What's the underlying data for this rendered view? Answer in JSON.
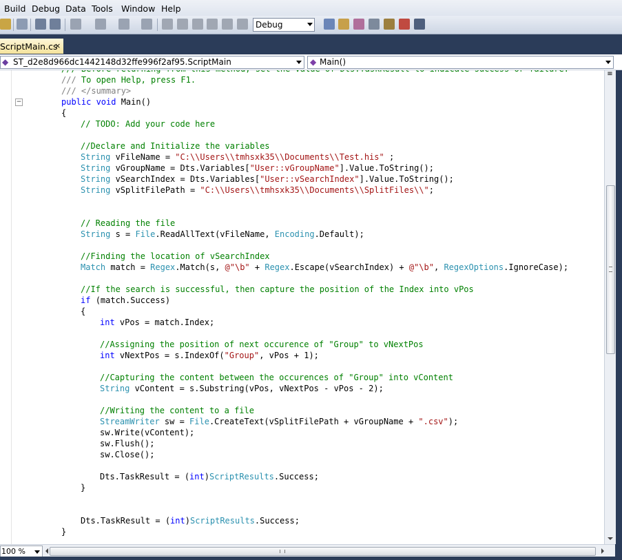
{
  "menu": [
    "Build",
    "Debug",
    "Data",
    "Tools",
    "Window",
    "Help"
  ],
  "toolbar": {
    "configuration": "Debug"
  },
  "tab": {
    "title": "ScriptMain.cs",
    "close": "×"
  },
  "nav": {
    "class_dropdown": "ST_d2e8d966dc1442148d32ffe996f2af95.ScriptMain",
    "member_dropdown": "Main()"
  },
  "code_lines": [
    [
      [
        "c",
        "/// Before returning from this method, set the value of Dts.TaskResult to indicate success or failure."
      ]
    ],
    [
      [
        "d",
        "/// "
      ],
      [
        "c",
        "To open Help, press F1."
      ]
    ],
    [
      [
        "d",
        "/// </summary>"
      ]
    ],
    [
      [
        "k",
        "public void "
      ],
      [
        "txt",
        "Main()"
      ]
    ],
    [
      [
        "txt",
        "{"
      ]
    ],
    [
      [
        "c",
        "// TODO: Add your code here"
      ]
    ],
    [],
    [
      [
        "c",
        "//Declare and Initialize the variables"
      ]
    ],
    [
      [
        "t",
        "String "
      ],
      [
        "txt",
        "vFileName = "
      ],
      [
        "s",
        "\"C:\\\\Users\\\\tmhsxk35\\\\Documents\\\\Test.his\""
      ],
      [
        "txt",
        " ;"
      ]
    ],
    [
      [
        "t",
        "String "
      ],
      [
        "txt",
        "vGroupName = Dts.Variables["
      ],
      [
        "s",
        "\"User::vGroupName\""
      ],
      [
        "txt",
        "].Value.ToString();"
      ]
    ],
    [
      [
        "t",
        "String "
      ],
      [
        "txt",
        "vSearchIndex = Dts.Variables["
      ],
      [
        "s",
        "\"User::vSearchIndex\""
      ],
      [
        "txt",
        "].Value.ToString();"
      ]
    ],
    [
      [
        "t",
        "String "
      ],
      [
        "txt",
        "vSplitFilePath = "
      ],
      [
        "s",
        "\"C:\\\\Users\\\\tmhsxk35\\\\Documents\\\\SplitFiles\\\\\""
      ],
      [
        "txt",
        ";"
      ]
    ],
    [],
    [],
    [
      [
        "c",
        "// Reading the file"
      ]
    ],
    [
      [
        "t",
        "String "
      ],
      [
        "txt",
        "s = "
      ],
      [
        "t",
        "File"
      ],
      [
        "txt",
        ".ReadAllText(vFileName, "
      ],
      [
        "t",
        "Encoding"
      ],
      [
        "txt",
        ".Default);"
      ]
    ],
    [],
    [
      [
        "c",
        "//Finding the location of vSearchIndex"
      ]
    ],
    [
      [
        "t",
        "Match "
      ],
      [
        "txt",
        "match = "
      ],
      [
        "t",
        "Regex"
      ],
      [
        "txt",
        ".Match(s, "
      ],
      [
        "s",
        "@\"\\b\""
      ],
      [
        "txt",
        " + "
      ],
      [
        "t",
        "Regex"
      ],
      [
        "txt",
        ".Escape(vSearchIndex) + "
      ],
      [
        "s",
        "@\"\\b\""
      ],
      [
        "txt",
        ", "
      ],
      [
        "t",
        "RegexOptions"
      ],
      [
        "txt",
        ".IgnoreCase);"
      ]
    ],
    [],
    [
      [
        "c",
        "//If the search is successful, then capture the position of the Index into vPos"
      ]
    ],
    [
      [
        "k",
        "if "
      ],
      [
        "txt",
        "(match.Success)"
      ]
    ],
    [
      [
        "txt",
        "{"
      ]
    ],
    [
      [
        "k",
        "int "
      ],
      [
        "txt",
        "vPos = match.Index;"
      ]
    ],
    [],
    [
      [
        "c",
        "//Assigning the position of next occurence of \"Group\" to vNextPos"
      ]
    ],
    [
      [
        "k",
        "int "
      ],
      [
        "txt",
        "vNextPos = s.IndexOf("
      ],
      [
        "s",
        "\"Group\""
      ],
      [
        "txt",
        ", vPos + 1);"
      ]
    ],
    [],
    [
      [
        "c",
        "//Capturing the content between the occurences of \"Group\" into vContent"
      ]
    ],
    [
      [
        "t",
        "String "
      ],
      [
        "txt",
        "vContent = s.Substring(vPos, vNextPos - vPos - 2);"
      ]
    ],
    [],
    [
      [
        "c",
        "//Writing the content to a file"
      ]
    ],
    [
      [
        "t",
        "StreamWriter "
      ],
      [
        "txt",
        "sw = "
      ],
      [
        "t",
        "File"
      ],
      [
        "txt",
        ".CreateText(vSplitFilePath + vGroupName + "
      ],
      [
        "s",
        "\".csv\""
      ],
      [
        "txt",
        ");"
      ]
    ],
    [
      [
        "txt",
        "sw.Write(vContent);"
      ]
    ],
    [
      [
        "txt",
        "sw.Flush();"
      ]
    ],
    [
      [
        "txt",
        "sw.Close();"
      ]
    ],
    [],
    [
      [
        "txt",
        "Dts.TaskResult = ("
      ],
      [
        "k",
        "int"
      ],
      [
        "txt",
        ")"
      ],
      [
        "t",
        "ScriptResults"
      ],
      [
        "txt",
        ".Success;"
      ]
    ],
    [
      [
        "txt",
        "}"
      ]
    ],
    [],
    [],
    [
      [
        "txt",
        "Dts.TaskResult = ("
      ],
      [
        "k",
        "int"
      ],
      [
        "txt",
        ")"
      ],
      [
        "t",
        "ScriptResults"
      ],
      [
        "txt",
        ".Success;"
      ]
    ],
    [
      [
        "txt",
        "}"
      ]
    ]
  ],
  "status": {
    "zoom": "100 %"
  },
  "colors": {
    "comment": "#008000",
    "keyword": "#0000ff",
    "type": "#2b91af",
    "string": "#a31515",
    "doc": "#808080"
  }
}
